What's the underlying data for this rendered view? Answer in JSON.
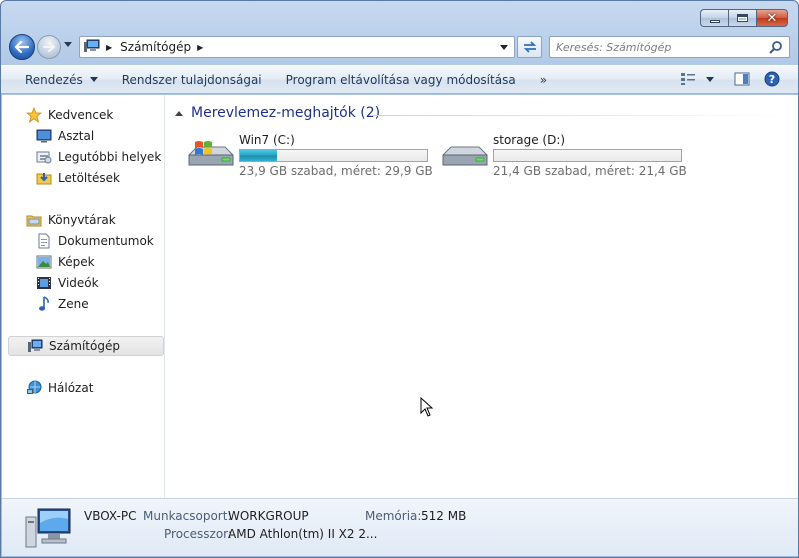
{
  "window": {
    "caption_buttons": [
      "minimize",
      "maximize",
      "close"
    ]
  },
  "address_bar": {
    "icon": "computer-icon",
    "breadcrumb": "Számítógép"
  },
  "search": {
    "placeholder": "Keresés: Számítógép"
  },
  "command_bar": {
    "organize": "Rendezés",
    "system_properties": "Rendszer tulajdonságai",
    "uninstall": "Program eltávolítása vagy módosítása",
    "more": "»"
  },
  "nav": {
    "favorites": "Kedvencek",
    "desktop": "Asztal",
    "recent": "Legutóbbi helyek",
    "downloads": "Letöltések",
    "libraries": "Könyvtárak",
    "documents": "Dokumentumok",
    "pictures": "Képek",
    "videos": "Videók",
    "music": "Zene",
    "computer": "Számítógép",
    "network": "Hálózat"
  },
  "group": {
    "title": "Merevlemez-meghajtók (2)"
  },
  "drives": [
    {
      "name": "Win7 (C:)",
      "info": "23,9 GB szabad, méret: 29,9 GB",
      "used_fraction": 0.2
    },
    {
      "name": "storage (D:)",
      "info": "21,4 GB szabad, méret: 21,4 GB",
      "used_fraction": 0.0
    }
  ],
  "details": {
    "computer_name": "VBOX-PC",
    "workgroup_label": "Munkacsoport:",
    "workgroup_value": "WORKGROUP",
    "memory_label": "Memória:",
    "memory_value": "512 MB",
    "processor_label": "Processzor:",
    "processor_value": "AMD Athlon(tm) II X2 2..."
  },
  "colors": {
    "accent": "#2d6bc2",
    "group_title": "#1e3287",
    "drive_fill": "#27a2c3"
  }
}
